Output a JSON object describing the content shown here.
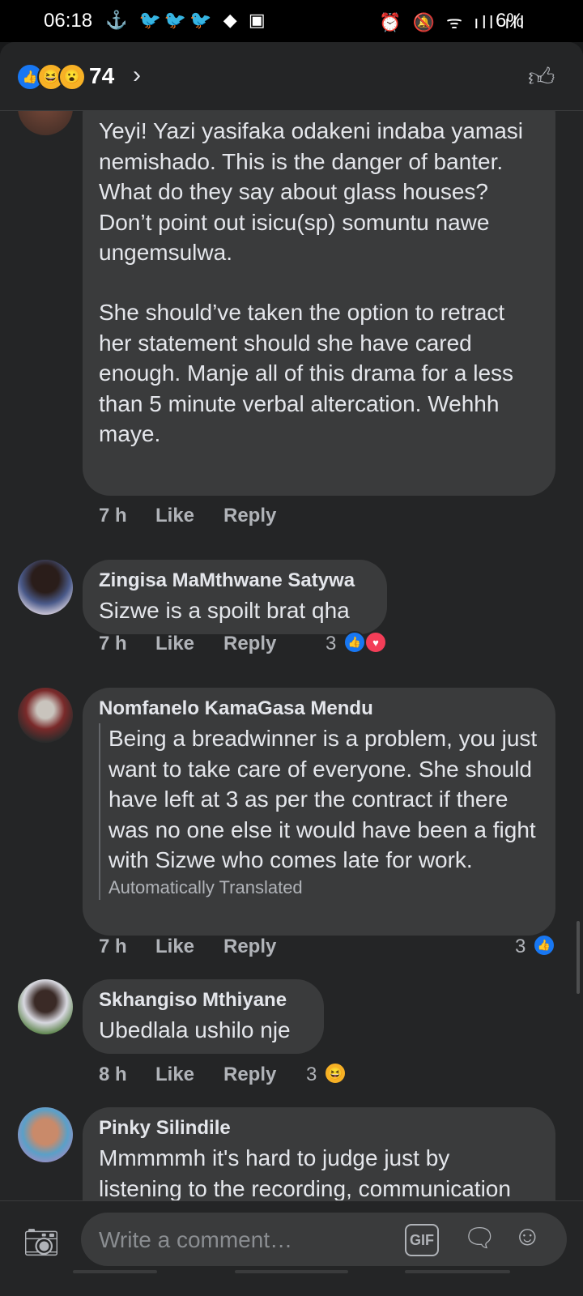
{
  "status_bar": {
    "time": "06:18",
    "left_icons": "⚓ 🐦🐦🐦 ◆ ▣",
    "right_icons": "⏰ 🔕 ᯤ ıll ıll",
    "battery": "6%"
  },
  "reactions_header": {
    "count": "74",
    "icons": [
      "like-icon",
      "haha-icon",
      "wow-icon"
    ]
  },
  "comments": [
    {
      "author": "",
      "paragraph1": "Yeyi! Yazi yasifaka odakeni indaba yamasi nemishado. This is the danger of banter. What do they say about glass houses? Don’t point out isicu(sp) somuntu nawe ungemsulwa.",
      "paragraph2": "She should’ve taken the option to retract her statement should she have cared enough. Manje all of this drama for a less than 5 minute verbal altercation. Wehhh maye.",
      "time": "7 h",
      "like": "Like",
      "reply": "Reply"
    },
    {
      "author": "Zingisa MaMthwane Satywa",
      "text": "Sizwe is a spoilt brat qha",
      "time": "7 h",
      "like": "Like",
      "reply": "Reply",
      "reaction_count": "3",
      "reactions": [
        "like",
        "love"
      ]
    },
    {
      "author": "Nomfanelo KamaGasa Mendu",
      "text": "Being a breadwinner is a problem, you just want to take care of everyone. She should have left at 3 as per the contract if there was no one else it would have been a fight with Sizwe who comes late for work.",
      "translated_label": "Automatically Translated",
      "time": "7 h",
      "like": "Like",
      "reply": "Reply",
      "reaction_count": "3",
      "reactions": [
        "like"
      ]
    },
    {
      "author": "Skhangiso Mthiyane",
      "text": "Ubedlala ushilo nje",
      "time": "8 h",
      "like": "Like",
      "reply": "Reply",
      "reaction_count": "3",
      "reactions": [
        "haha"
      ]
    },
    {
      "author": "Pinky Silindile",
      "text": "Mmmmmh it's hard to judge just by listening to the recording, communication goes a long way and to"
    }
  ],
  "composer": {
    "placeholder": "Write a comment…",
    "gif_label": "GIF"
  },
  "colors": {
    "background": "#242526",
    "bubble": "#3a3b3c",
    "like_blue": "#1877f2",
    "love_red": "#f33e58",
    "haha_yellow": "#f7b125"
  }
}
